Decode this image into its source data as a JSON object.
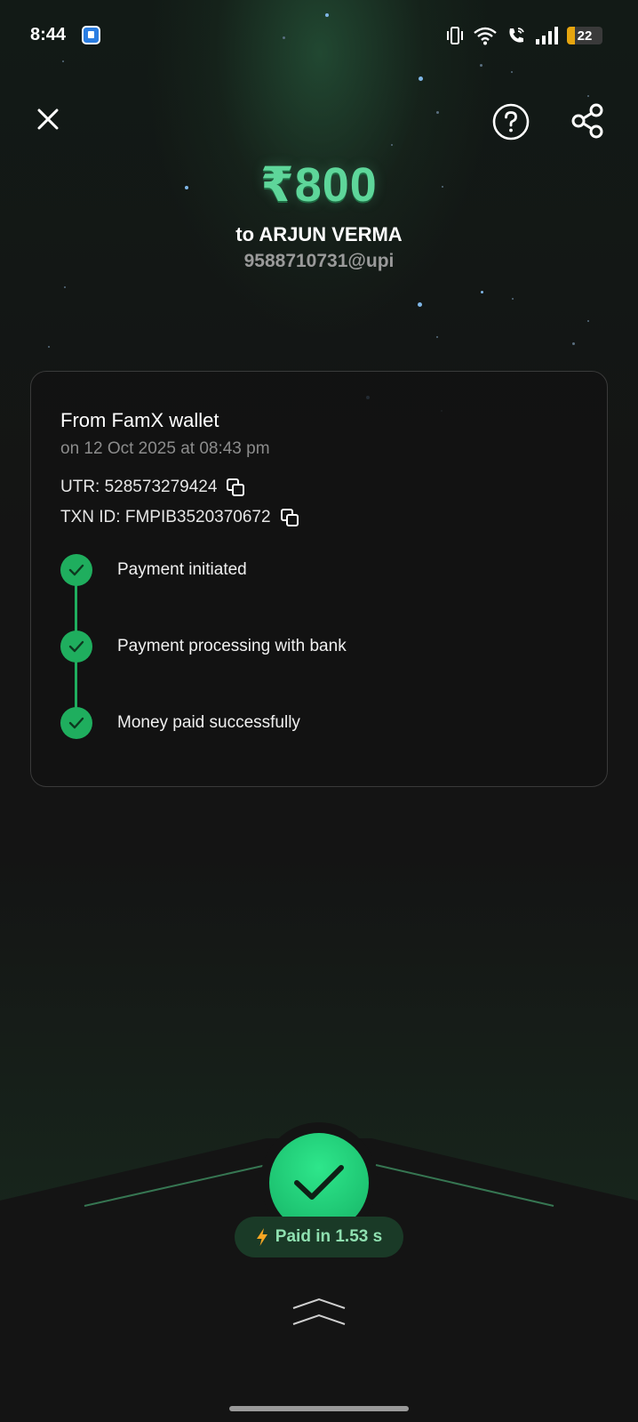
{
  "status_bar": {
    "time": "8:44",
    "battery_level": "22",
    "battery_fraction": 0.22,
    "icons": [
      "app-notification-icon",
      "vibrate-icon",
      "wifi-icon",
      "wifi-call-icon",
      "signal-icon",
      "battery-icon"
    ]
  },
  "header": {
    "icons": [
      "close-icon",
      "help-icon",
      "share-icon"
    ]
  },
  "payment": {
    "amount": "₹800",
    "recipient": "to ARJUN VERMA",
    "upi_id": "9588710731@upi"
  },
  "details": {
    "source": "From FamX wallet",
    "date": "on 12 Oct 2025 at 08:43 pm",
    "utr": "UTR: 528573279424",
    "txn_id": "TXN ID: FMPIB3520370672"
  },
  "timeline": {
    "steps": [
      {
        "label": "Payment initiated",
        "done": true
      },
      {
        "label": "Payment processing with bank",
        "done": true
      },
      {
        "label": "Money paid successfully",
        "done": true
      }
    ]
  },
  "result": {
    "paid_label": "Paid in 1.53 s"
  },
  "colors": {
    "accent": "#5ed69a",
    "success": "#1fae5e",
    "battery": "#e6a50f"
  }
}
